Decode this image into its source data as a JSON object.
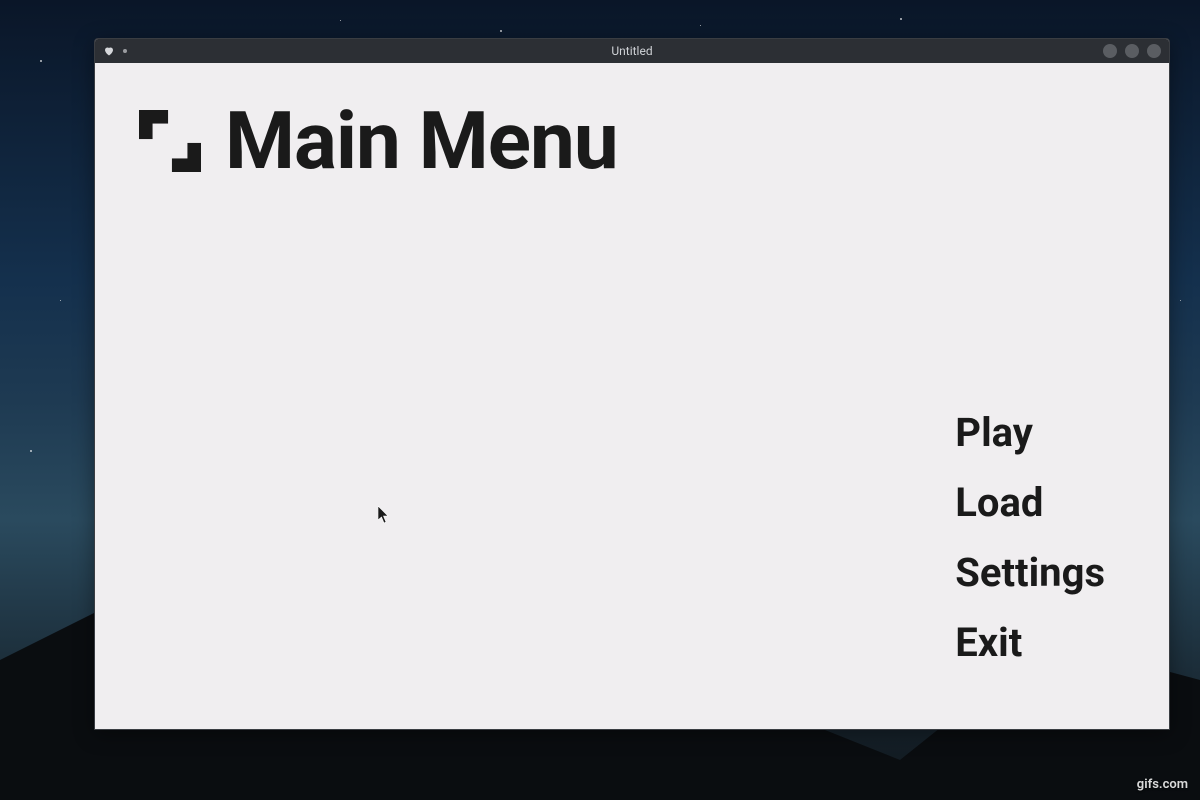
{
  "window": {
    "title": "Untitled"
  },
  "header": {
    "title": "Main Menu"
  },
  "menu": {
    "items": [
      {
        "label": "Play"
      },
      {
        "label": "Load"
      },
      {
        "label": "Settings"
      },
      {
        "label": "Exit"
      }
    ]
  },
  "watermark": "gifs.com",
  "icons": {
    "heart": "heart-icon",
    "logo": "logo-icon",
    "cursor": "cursor-icon"
  },
  "colors": {
    "titlebar": "#2c2f34",
    "content_bg": "#f0eef0",
    "text": "#1a1a1a",
    "control_dot": "#5a5d62"
  }
}
